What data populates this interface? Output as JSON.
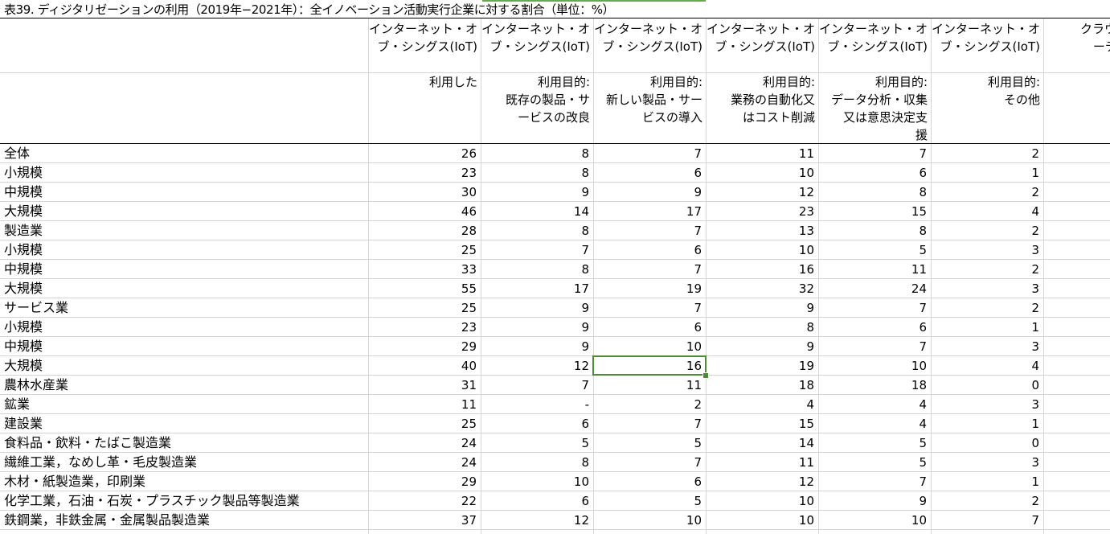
{
  "title": "表39. ディジタリゼーションの利用（2019年−2021年）：全イノベーション活動実行企業に対する割合（単位：%）",
  "headers": [
    {
      "group": [
        "インターネット・オ",
        "ブ・シングス(IoT)"
      ],
      "sub": [
        "利用した"
      ]
    },
    {
      "group": [
        "インターネット・オ",
        "ブ・シングス(IoT)"
      ],
      "sub": [
        "利用目的:",
        "既存の製品・サ",
        "ービスの改良"
      ]
    },
    {
      "group": [
        "インターネット・オ",
        "ブ・シングス(IoT)"
      ],
      "sub": [
        "利用目的:",
        "新しい製品・サー",
        "ビスの導入"
      ]
    },
    {
      "group": [
        "インターネット・オ",
        "ブ・シングス(IoT)"
      ],
      "sub": [
        "利用目的:",
        "業務の自動化又",
        "はコスト削減"
      ]
    },
    {
      "group": [
        "インターネット・オ",
        "ブ・シングス(IoT)"
      ],
      "sub": [
        "利用目的:",
        "データ分析・収集",
        "又は意思決定支",
        "援"
      ]
    },
    {
      "group": [
        "インターネット・オ",
        "ブ・シングス(IoT)"
      ],
      "sub": [
        "利用目的:",
        "その他"
      ]
    },
    {
      "group": [
        "クラウド・コ",
        "ーティング"
      ],
      "sub": [
        "利"
      ]
    }
  ],
  "rows": [
    {
      "label": "全体",
      "values": [
        "26",
        "8",
        "7",
        "11",
        "7",
        "2"
      ]
    },
    {
      "label": "小規模",
      "values": [
        "23",
        "8",
        "6",
        "10",
        "6",
        "1"
      ]
    },
    {
      "label": "中規模",
      "values": [
        "30",
        "9",
        "9",
        "12",
        "8",
        "2"
      ]
    },
    {
      "label": "大規模",
      "values": [
        "46",
        "14",
        "17",
        "23",
        "15",
        "4"
      ]
    },
    {
      "label": "製造業",
      "values": [
        "28",
        "8",
        "7",
        "13",
        "8",
        "2"
      ]
    },
    {
      "label": "小規模",
      "values": [
        "25",
        "7",
        "6",
        "10",
        "5",
        "3"
      ]
    },
    {
      "label": "中規模",
      "values": [
        "33",
        "8",
        "7",
        "16",
        "11",
        "2"
      ]
    },
    {
      "label": "大規模",
      "values": [
        "55",
        "17",
        "19",
        "32",
        "24",
        "3"
      ]
    },
    {
      "label": "サービス業",
      "values": [
        "25",
        "9",
        "7",
        "9",
        "7",
        "2"
      ]
    },
    {
      "label": "小規模",
      "values": [
        "23",
        "9",
        "6",
        "8",
        "6",
        "1"
      ]
    },
    {
      "label": "中規模",
      "values": [
        "29",
        "9",
        "10",
        "9",
        "7",
        "3"
      ]
    },
    {
      "label": "大規模",
      "values": [
        "40",
        "12",
        "16",
        "19",
        "10",
        "4"
      ]
    },
    {
      "label": "農林水産業",
      "values": [
        "31",
        "7",
        "11",
        "18",
        "18",
        "0"
      ]
    },
    {
      "label": "鉱業",
      "values": [
        "11",
        "-",
        "2",
        "4",
        "4",
        "3"
      ]
    },
    {
      "label": "建設業",
      "values": [
        "25",
        "6",
        "7",
        "15",
        "4",
        "1"
      ]
    },
    {
      "label": "食料品・飲料・たばこ製造業",
      "values": [
        "24",
        "5",
        "5",
        "14",
        "5",
        "0"
      ]
    },
    {
      "label": "繊維工業，なめし革・毛皮製造業",
      "values": [
        "24",
        "8",
        "7",
        "11",
        "5",
        "3"
      ]
    },
    {
      "label": "木材・紙製造業，印刷業",
      "values": [
        "29",
        "10",
        "6",
        "12",
        "7",
        "1"
      ]
    },
    {
      "label": "化学工業，石油・石炭・プラスチック製品等製造業",
      "values": [
        "22",
        "6",
        "5",
        "10",
        "9",
        "2"
      ]
    },
    {
      "label": "鉄鋼業，非鉄金属・金属製品製造業",
      "values": [
        "37",
        "12",
        "10",
        "10",
        "10",
        "7"
      ]
    }
  ],
  "selected_cell": {
    "row": 12,
    "column": 3
  },
  "colors": {
    "selection": "#4c8a35",
    "gridline": "#d4d4d4"
  }
}
